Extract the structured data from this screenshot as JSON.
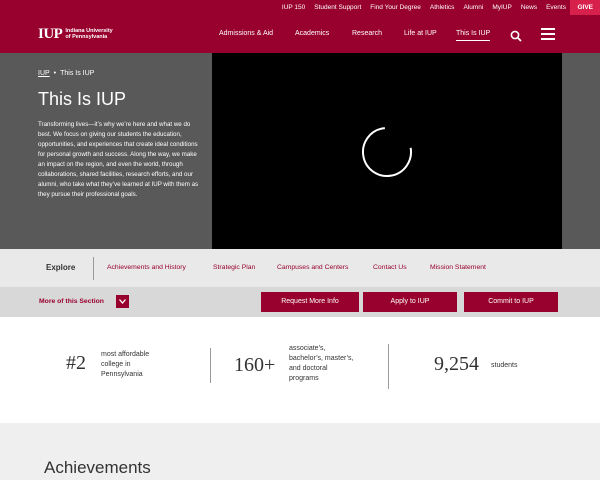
{
  "utility_nav": [
    "IUP 150",
    "Student Support",
    "Find Your Degree",
    "Athletics",
    "Alumni",
    "MyIUP",
    "News",
    "Events"
  ],
  "give_label": "GIVE",
  "logo": {
    "mark": "IUP",
    "line1": "Indiana University",
    "line2": "of Pennsylvania"
  },
  "main_nav": [
    "Admissions & Aid",
    "Academics",
    "Research",
    "Life at IUP",
    "This Is IUP"
  ],
  "main_nav_active": "This Is IUP",
  "breadcrumb": {
    "home": "IUP",
    "separator": "•",
    "current": "This Is IUP"
  },
  "page_title": "This Is IUP",
  "hero_description": "Transforming lives—it’s why we’re here and what we do best. We focus on giving our students the education, opportunities, and experiences that create ideal conditions for personal growth and success. Along the way, we make an impact on the region, and even the world, through collaborations, shared facilities, research efforts, and our alumni, who take what they’ve learned at IUP with them as they pursue their professional goals.",
  "explore": {
    "label": "Explore",
    "links": [
      "Achievements and History",
      "Strategic Plan",
      "Campuses and Centers",
      "Contact Us",
      "Mission Statement"
    ]
  },
  "more_section": {
    "label": "More of this Section"
  },
  "cta_buttons": [
    "Request More Info",
    "Apply to IUP",
    "Commit to IUP"
  ],
  "stats": [
    {
      "number": "#2",
      "text_lines": [
        "most affordable",
        "college in",
        "Pennsylvania"
      ]
    },
    {
      "number": "160+",
      "text_lines": [
        "associate’s,",
        "bachelor’s, master’s,",
        "and doctoral",
        "programs"
      ]
    },
    {
      "number": "9,254",
      "text_lines": [
        "students"
      ]
    }
  ],
  "achievements_heading": "Achievements",
  "colors": {
    "brand": "#98002e",
    "give": "#d8204c",
    "hero_gray": "#595959"
  },
  "icons": {
    "search": "search-icon",
    "menu": "hamburger-menu-icon",
    "toggle": "chevron-down-icon",
    "loading": "loading-spinner-icon"
  }
}
